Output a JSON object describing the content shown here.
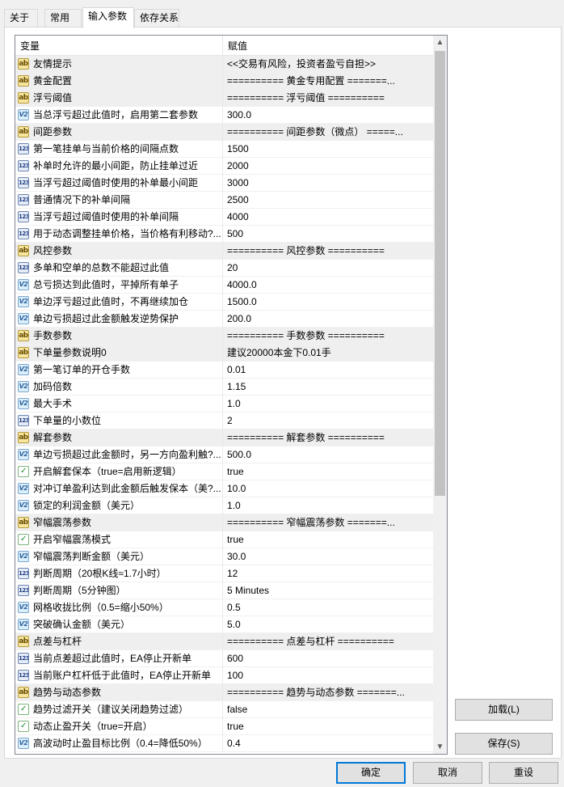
{
  "tabs": [
    {
      "label": "关于"
    },
    {
      "label": "常用"
    },
    {
      "label": "输入参数"
    },
    {
      "label": "依存关系"
    }
  ],
  "grid": {
    "col_variable": "变量",
    "col_value": "赋值",
    "rows": [
      {
        "type": "ab",
        "name": "友情提示",
        "value": "<<交易有风险，投资者盈亏自担>>"
      },
      {
        "type": "ab",
        "name": "黄金配置",
        "value": "========== 黄金专用配置 =======..."
      },
      {
        "type": "ab",
        "name": "浮亏阈值",
        "value": "========== 浮亏阈值 =========="
      },
      {
        "type": "v2",
        "name": "当总浮亏超过此值时，启用第二套参数",
        "value": "300.0"
      },
      {
        "type": "ab",
        "name": "间距参数",
        "value": "========== 间距参数（微点） =====..."
      },
      {
        "type": "n123",
        "name": "第一笔挂单与当前价格的间隔点数",
        "value": "1500"
      },
      {
        "type": "n123",
        "name": "补单时允许的最小间距，防止挂单过近",
        "value": "2000"
      },
      {
        "type": "n123",
        "name": "当浮亏超过阈值时使用的补单最小间距",
        "value": "3000"
      },
      {
        "type": "n123",
        "name": "普通情况下的补单间隔",
        "value": "2500"
      },
      {
        "type": "n123",
        "name": "当浮亏超过阈值时使用的补单间隔",
        "value": "4000"
      },
      {
        "type": "n123",
        "name": "用于动态调整挂单价格，当价格有利移动?...",
        "value": "500"
      },
      {
        "type": "ab",
        "name": "风控参数",
        "value": "========== 风控参数 =========="
      },
      {
        "type": "n123",
        "name": "多单和空单的总数不能超过此值",
        "value": "20"
      },
      {
        "type": "v2",
        "name": "总亏损达到此值时，平掉所有单子",
        "value": "4000.0"
      },
      {
        "type": "v2",
        "name": "单边浮亏超过此值时，不再继续加仓",
        "value": "1500.0"
      },
      {
        "type": "v2",
        "name": "单边亏损超过此金额触发逆势保护",
        "value": "200.0"
      },
      {
        "type": "ab",
        "name": "手数参数",
        "value": "========== 手数参数 =========="
      },
      {
        "type": "ab",
        "name": "下单量参数说明0",
        "value": "建议20000本金下0.01手"
      },
      {
        "type": "v2",
        "name": "第一笔订单的开仓手数",
        "value": "0.01"
      },
      {
        "type": "v2",
        "name": "加码倍数",
        "value": "1.15"
      },
      {
        "type": "v2",
        "name": "最大手术",
        "value": "1.0"
      },
      {
        "type": "n123",
        "name": "下单量的小数位",
        "value": "2"
      },
      {
        "type": "ab",
        "name": "解套参数",
        "value": "========== 解套参数 =========="
      },
      {
        "type": "v2",
        "name": "单边亏损超过此金额时，另一方向盈利触?...",
        "value": "500.0"
      },
      {
        "type": "bool",
        "name": "开启解套保本（true=启用新逻辑）",
        "value": "true"
      },
      {
        "type": "v2",
        "name": "对冲订单盈利达到此金额后触发保本（美?...",
        "value": "10.0"
      },
      {
        "type": "v2",
        "name": "锁定的利润金额（美元）",
        "value": "1.0"
      },
      {
        "type": "ab",
        "name": "窄幅震荡参数",
        "value": "========== 窄幅震荡参数 =======..."
      },
      {
        "type": "bool",
        "name": "开启窄幅震荡模式",
        "value": "true"
      },
      {
        "type": "v2",
        "name": "窄幅震荡判断金额（美元）",
        "value": "30.0"
      },
      {
        "type": "n123",
        "name": "判断周期（20根K线≈1.7小时）",
        "value": "12"
      },
      {
        "type": "n123",
        "name": "判断周期（5分钟图）",
        "value": "5 Minutes"
      },
      {
        "type": "v2",
        "name": "网格收拢比例（0.5=缩小50%）",
        "value": "0.5"
      },
      {
        "type": "v2",
        "name": "突破确认金额（美元）",
        "value": "5.0"
      },
      {
        "type": "ab",
        "name": "点差与杠杆",
        "value": "========== 点差与杠杆 =========="
      },
      {
        "type": "n123",
        "name": "当前点差超过此值时，EA停止开新单",
        "value": "600"
      },
      {
        "type": "n123",
        "name": "当前账户杠杆低于此值时，EA停止开新单",
        "value": "100"
      },
      {
        "type": "ab",
        "name": "趋势与动态参数",
        "value": "========== 趋势与动态参数 =======..."
      },
      {
        "type": "bool",
        "name": "趋势过滤开关（建议关闭趋势过滤）",
        "value": "false"
      },
      {
        "type": "bool",
        "name": "动态止盈开关（true=开启）",
        "value": "true"
      },
      {
        "type": "v2",
        "name": "高波动时止盈目标比例（0.4=降低50%）",
        "value": "0.4"
      }
    ]
  },
  "icons": {
    "ab": "ab",
    "v2": "V2",
    "n123": "123",
    "bool": "✓"
  },
  "buttons": {
    "load": "加载(L)",
    "save": "保存(S)",
    "ok": "确定",
    "cancel": "取消",
    "reset": "重设"
  }
}
